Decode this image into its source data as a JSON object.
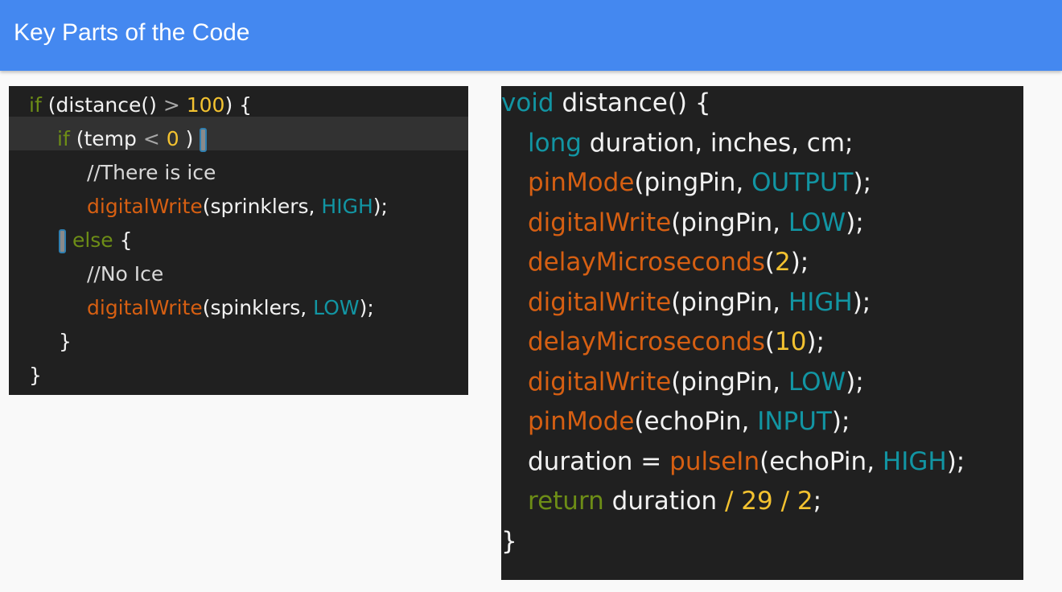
{
  "header": {
    "title": "Key Parts of the Code"
  },
  "left_code": {
    "lines": [
      [
        [
          "olive",
          "if"
        ],
        [
          "white",
          " (distance() "
        ],
        [
          "gray",
          ">"
        ],
        [
          "white",
          " "
        ],
        [
          "yellow",
          "100"
        ],
        [
          "white",
          ") {"
        ]
      ],
      [
        [
          "olive",
          "if"
        ],
        [
          "white",
          " (temp "
        ],
        [
          "gray",
          "<"
        ],
        [
          "white",
          " "
        ],
        [
          "yellow",
          "0"
        ],
        [
          "white",
          " ) "
        ]
      ],
      [
        [
          "comment",
          "//There is ice"
        ]
      ],
      [
        [
          "orange",
          "digitalWrite"
        ],
        [
          "white",
          "(sprinklers, "
        ],
        [
          "teal",
          "HIGH"
        ],
        [
          "white",
          ");"
        ]
      ],
      [
        [
          "olive",
          " else"
        ],
        [
          "white",
          " {"
        ]
      ],
      [
        [
          "comment",
          "//No Ice"
        ]
      ],
      [
        [
          "orange",
          "digitalWrite"
        ],
        [
          "white",
          "(spinklers, "
        ],
        [
          "teal",
          "LOW"
        ],
        [
          "white",
          ");"
        ]
      ],
      [
        [
          "white",
          "}"
        ]
      ],
      [
        [
          "white",
          "}"
        ]
      ]
    ]
  },
  "right_code": {
    "lines": [
      [
        [
          "teal",
          "void"
        ],
        [
          "white",
          " distance() {"
        ]
      ],
      [
        [
          "teal",
          "long"
        ],
        [
          "white",
          " duration, inches, cm;"
        ]
      ],
      [
        [
          "orange",
          "pinMode"
        ],
        [
          "white",
          "(pingPin, "
        ],
        [
          "teal",
          "OUTPUT"
        ],
        [
          "white",
          ");"
        ]
      ],
      [
        [
          "orange",
          "digitalWrite"
        ],
        [
          "white",
          "(pingPin, "
        ],
        [
          "teal",
          "LOW"
        ],
        [
          "white",
          ");"
        ]
      ],
      [
        [
          "orange",
          "delayMicroseconds"
        ],
        [
          "white",
          "("
        ],
        [
          "yellow",
          "2"
        ],
        [
          "white",
          ");"
        ]
      ],
      [
        [
          "orange",
          "digitalWrite"
        ],
        [
          "white",
          "(pingPin, "
        ],
        [
          "teal",
          "HIGH"
        ],
        [
          "white",
          ");"
        ]
      ],
      [
        [
          "orange",
          "delayMicroseconds"
        ],
        [
          "white",
          "("
        ],
        [
          "yellow",
          "10"
        ],
        [
          "white",
          ");"
        ]
      ],
      [
        [
          "orange",
          "digitalWrite"
        ],
        [
          "white",
          "(pingPin, "
        ],
        [
          "teal",
          "LOW"
        ],
        [
          "white",
          ");"
        ]
      ],
      [
        [
          "orange",
          "pinMode"
        ],
        [
          "white",
          "(echoPin, "
        ],
        [
          "teal",
          "INPUT"
        ],
        [
          "white",
          ");"
        ]
      ],
      [
        [
          "white",
          "duration = "
        ],
        [
          "orange",
          "pulseIn"
        ],
        [
          "white",
          "(echoPin, "
        ],
        [
          "teal",
          "HIGH"
        ],
        [
          "white",
          ");"
        ]
      ],
      [
        [
          "olive",
          "return"
        ],
        [
          "white",
          " duration "
        ],
        [
          "yellow",
          "/"
        ],
        [
          "white",
          " "
        ],
        [
          "yellow",
          "29"
        ],
        [
          "white",
          " "
        ],
        [
          "yellow",
          "/"
        ],
        [
          "white",
          " "
        ],
        [
          "yellow",
          "2"
        ],
        [
          "white",
          ";"
        ]
      ],
      [
        [
          "white",
          "}"
        ]
      ]
    ]
  },
  "colors": {
    "header_bg": "#4488f0",
    "code_bg": "#202020",
    "olive": "#6d8d16",
    "orange": "#d65f12",
    "teal": "#1295a3",
    "yellow": "#f3c230"
  }
}
